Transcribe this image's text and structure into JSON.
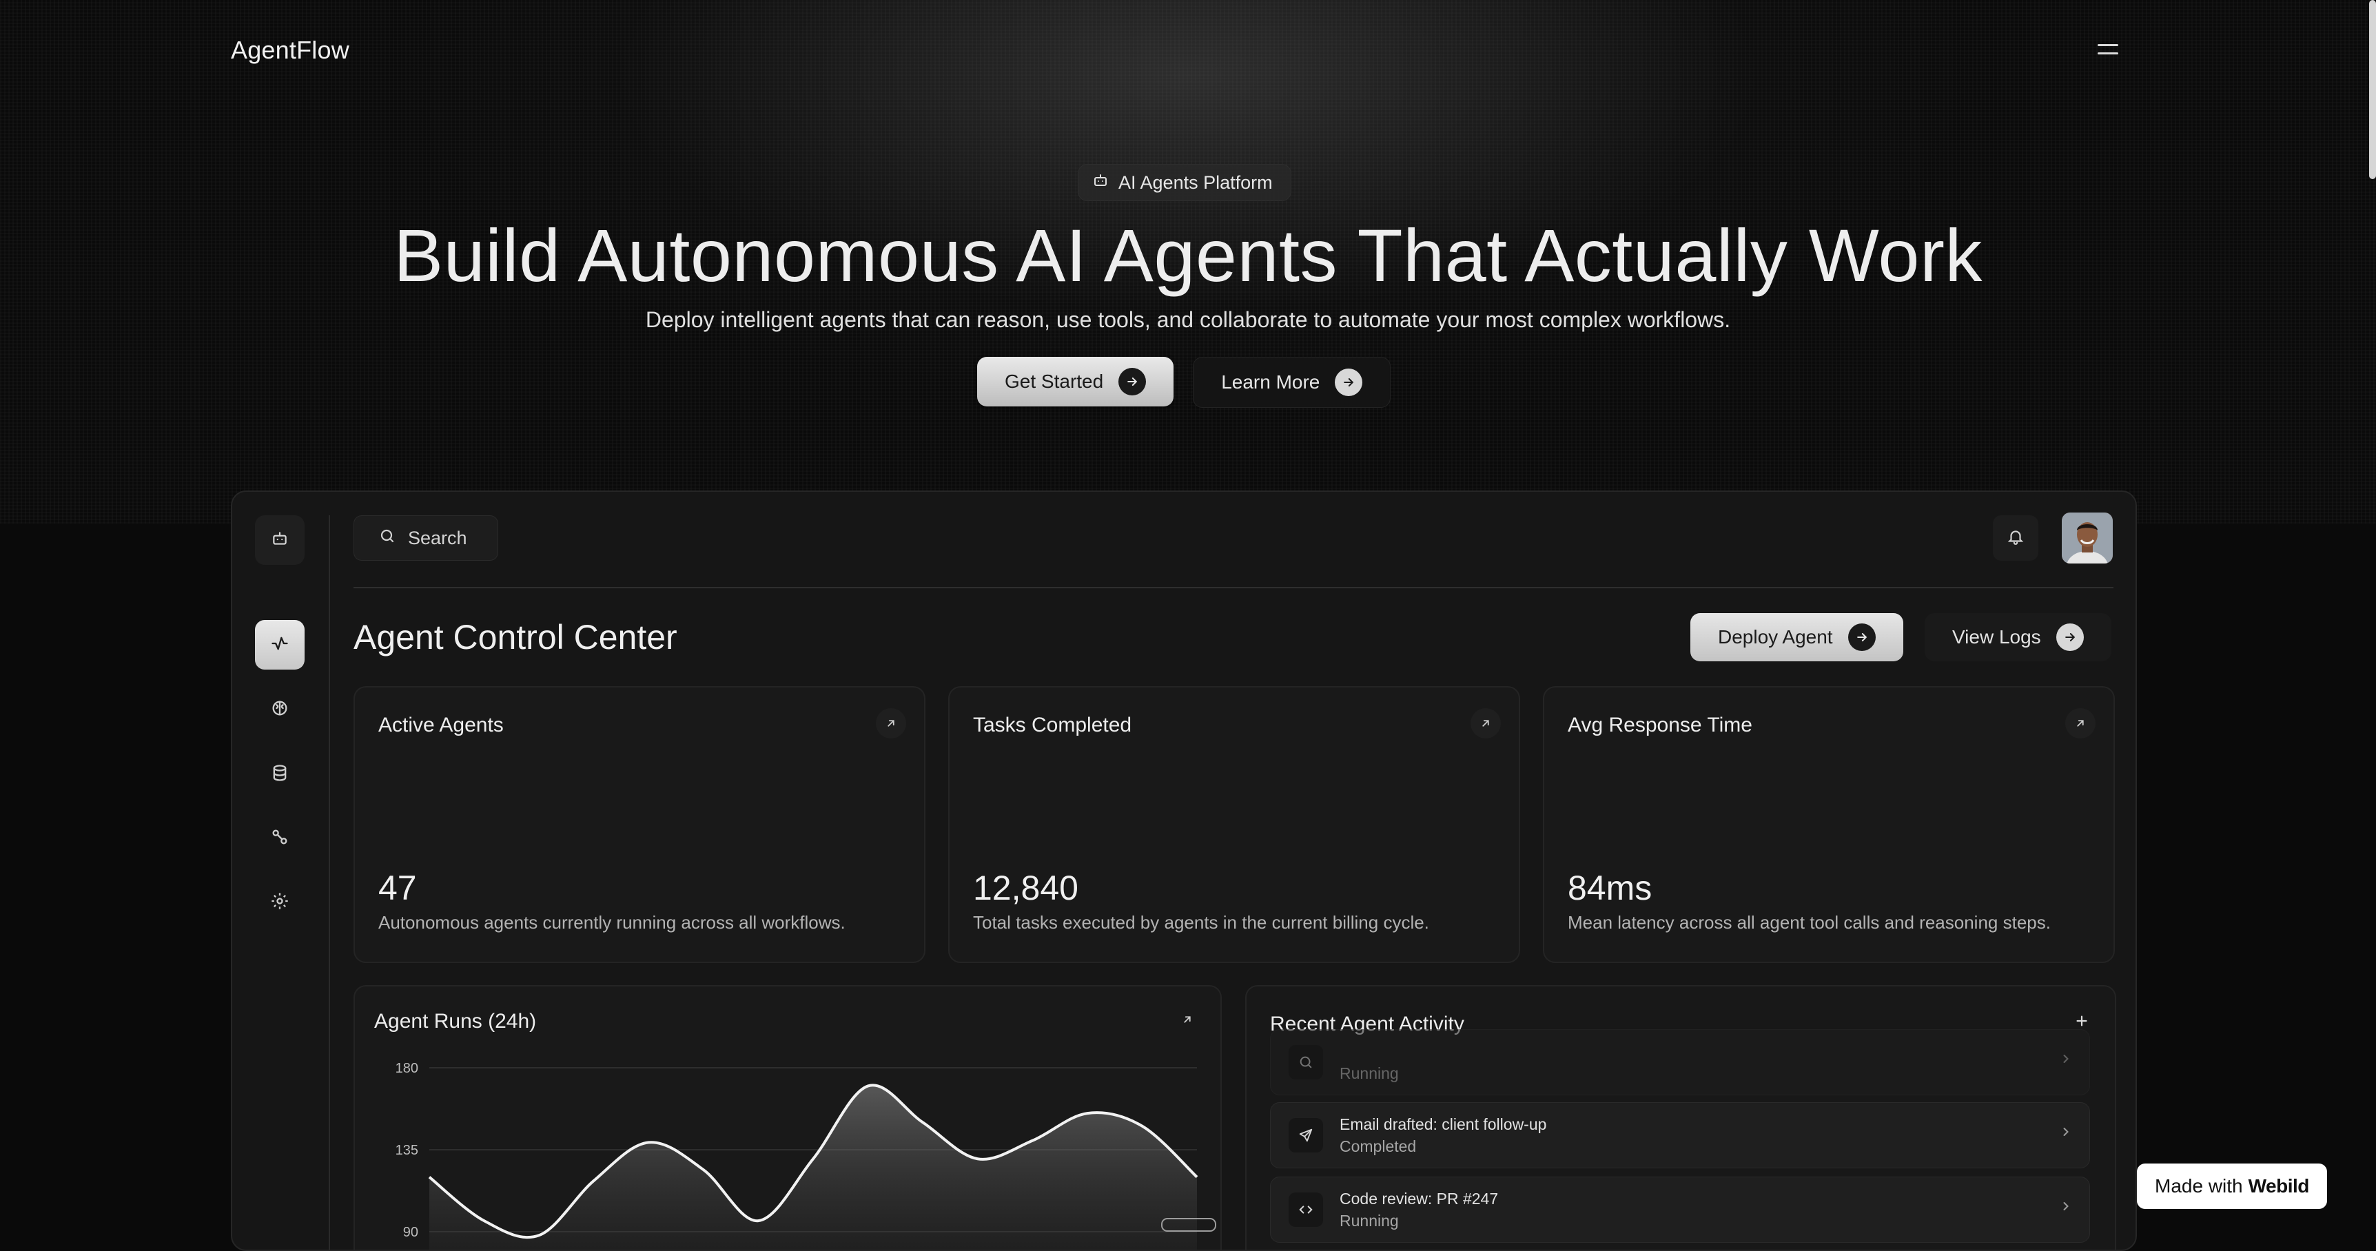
{
  "nav": {
    "brand": "AgentFlow",
    "menu_icon": "hamburger-icon"
  },
  "hero": {
    "badge": "AI Agents Platform",
    "badge_icon": "bot-icon",
    "title": "Build Autonomous AI Agents That Actually Work",
    "subtitle": "Deploy intelligent agents that can reason, use tools, and collaborate to automate your most complex workflows.",
    "primary_cta": "Get Started",
    "secondary_cta": "Learn More"
  },
  "dashboard": {
    "sidebar": [
      {
        "icon": "bot-icon",
        "name": "logo"
      },
      {
        "icon": "activity-icon",
        "name": "activity",
        "active": true
      },
      {
        "icon": "brain-icon",
        "name": "models"
      },
      {
        "icon": "database-icon",
        "name": "data"
      },
      {
        "icon": "workflow-icon",
        "name": "workflows"
      },
      {
        "icon": "gear-icon",
        "name": "settings"
      }
    ],
    "search_placeholder": "Search",
    "title": "Agent Control Center",
    "deploy_label": "Deploy Agent",
    "logs_label": "View Logs",
    "stats": [
      {
        "label": "Active Agents",
        "value": "47",
        "desc": "Autonomous agents currently running across all workflows."
      },
      {
        "label": "Tasks Completed",
        "value": "12,840",
        "desc": "Total tasks executed by agents in the current billing cycle."
      },
      {
        "label": "Avg Response Time",
        "value": "84ms",
        "desc": "Mean latency across all agent tool calls and reasoning steps."
      }
    ],
    "chart_title": "Agent Runs (24h)",
    "activity": {
      "title": "Recent Agent Activity",
      "items": [
        {
          "title": "",
          "status": "Running",
          "icon": "search-icon"
        },
        {
          "title": "Email drafted: client follow-up",
          "status": "Completed",
          "icon": "send-icon"
        },
        {
          "title": "Code review: PR #247",
          "status": "Running",
          "icon": "code-icon"
        }
      ]
    }
  },
  "chart_data": {
    "type": "area",
    "title": "Agent Runs (24h)",
    "y_ticks": [
      "180",
      "135",
      "90"
    ],
    "ylim": [
      90,
      180
    ],
    "series": [
      {
        "values": [
          120,
          96,
          88,
          118,
          139,
          124,
          96,
          130,
          170,
          150,
          130,
          140,
          155,
          148,
          120
        ]
      }
    ],
    "grid": true
  },
  "badge": {
    "prefix": "Made with",
    "brand": "Webild"
  }
}
